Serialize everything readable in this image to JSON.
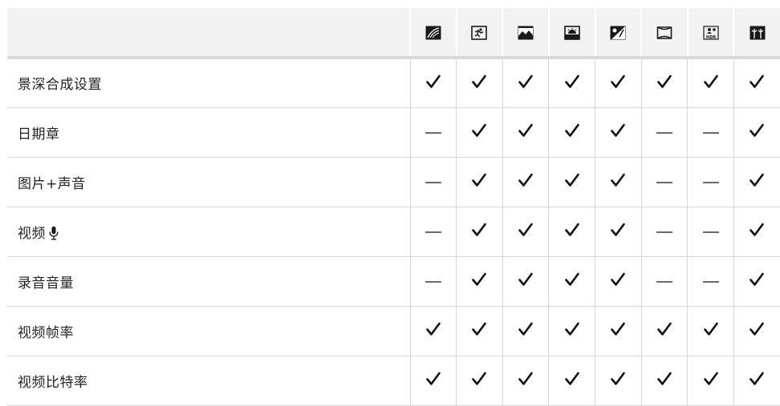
{
  "header": {
    "label_cell": "",
    "modes": [
      {
        "icon": "advanced-filter-icon"
      },
      {
        "icon": "sports-icon"
      },
      {
        "icon": "landscape-icon"
      },
      {
        "icon": "sunset-icon"
      },
      {
        "icon": "snow-icon"
      },
      {
        "icon": "panorama-icon"
      },
      {
        "icon": "hdr-icon"
      },
      {
        "icon": "fireworks-icon"
      }
    ]
  },
  "rows": [
    {
      "label": "景深合成设置",
      "has_mic_icon": false,
      "values": [
        "check",
        "check",
        "check",
        "check",
        "check",
        "check",
        "check",
        "check"
      ]
    },
    {
      "label": "日期章",
      "has_mic_icon": false,
      "values": [
        "dash",
        "check",
        "check",
        "check",
        "check",
        "dash",
        "dash",
        "check"
      ]
    },
    {
      "label": "图片+声音",
      "has_mic_icon": false,
      "values": [
        "dash",
        "check",
        "check",
        "check",
        "check",
        "dash",
        "dash",
        "check"
      ]
    },
    {
      "label": "视频",
      "has_mic_icon": true,
      "values": [
        "dash",
        "check",
        "check",
        "check",
        "check",
        "dash",
        "dash",
        "check"
      ]
    },
    {
      "label": "录音音量",
      "has_mic_icon": false,
      "values": [
        "dash",
        "check",
        "check",
        "check",
        "check",
        "dash",
        "dash",
        "check"
      ]
    },
    {
      "label": "视频帧率",
      "has_mic_icon": false,
      "values": [
        "check",
        "check",
        "check",
        "check",
        "check",
        "check",
        "check",
        "check"
      ]
    },
    {
      "label": "视频比特率",
      "has_mic_icon": false,
      "values": [
        "check",
        "check",
        "check",
        "check",
        "check",
        "check",
        "check",
        "check"
      ]
    }
  ],
  "colors": {
    "header_bg": "#f2f2f2",
    "grid": "#d6d6d6",
    "header_rule": "#d9d9d9",
    "check": "#111111",
    "dash": "#6a6a6a",
    "icon_fill": "#1a1a1a"
  }
}
